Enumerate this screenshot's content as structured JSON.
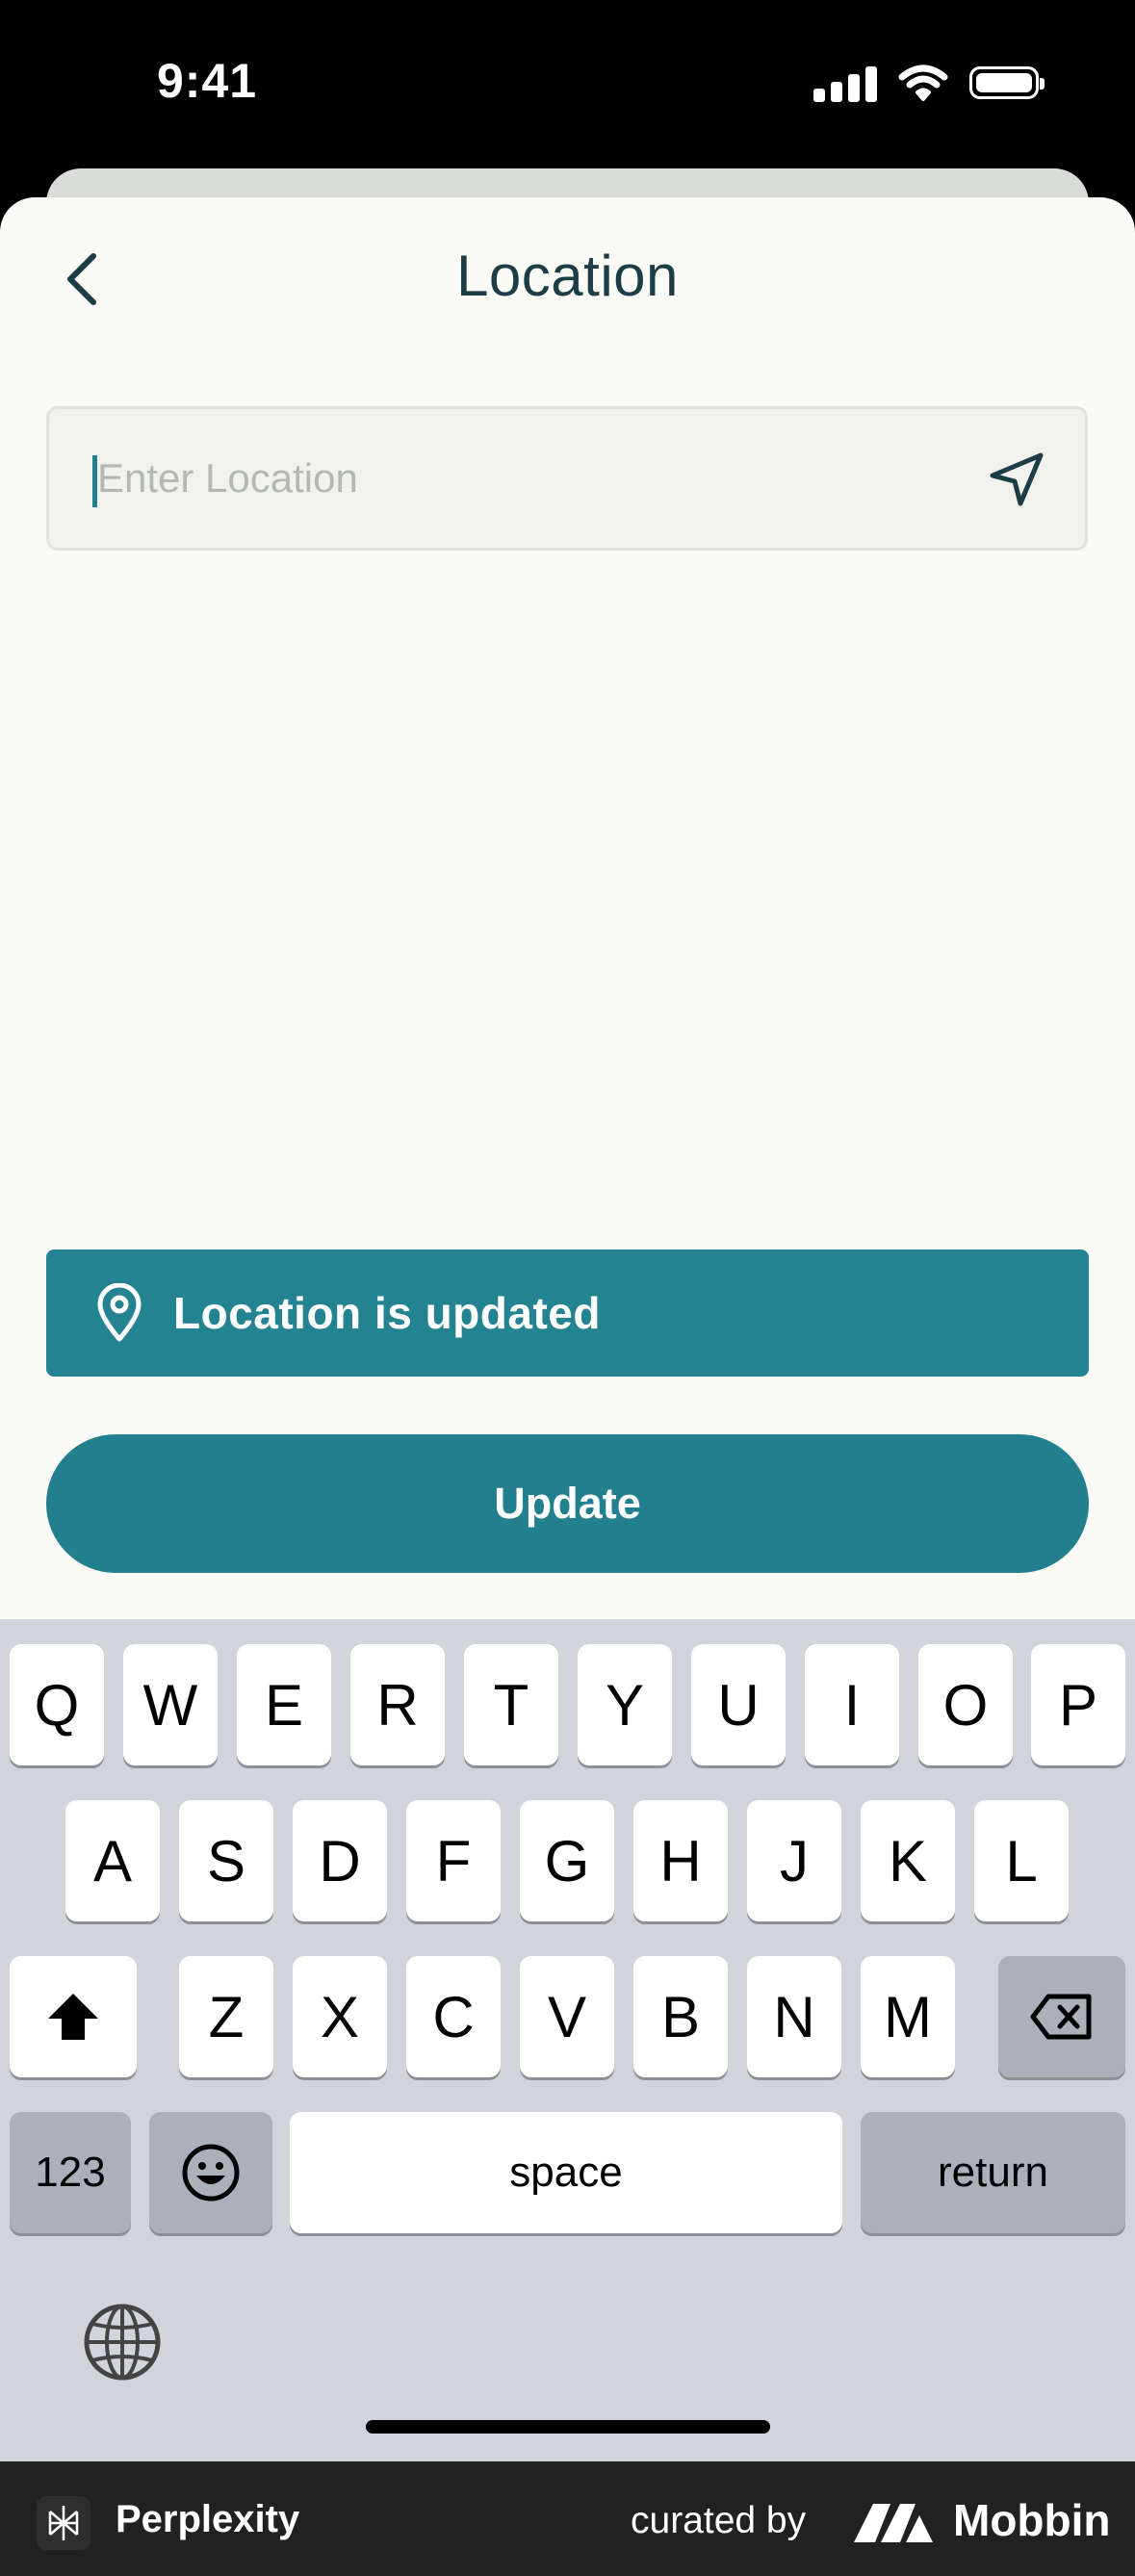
{
  "status_bar": {
    "time": "9:41"
  },
  "header": {
    "title": "Location",
    "back_icon": "chevron-left-icon"
  },
  "search": {
    "placeholder": "Enter Location",
    "value": "",
    "action_icon": "navigation-arrow-icon"
  },
  "toast": {
    "icon": "map-pin-icon",
    "message": "Location is updated"
  },
  "primary_action": {
    "label": "Update"
  },
  "keyboard": {
    "row1": [
      "Q",
      "W",
      "E",
      "R",
      "T",
      "Y",
      "U",
      "I",
      "O",
      "P"
    ],
    "row2": [
      "A",
      "S",
      "D",
      "F",
      "G",
      "H",
      "J",
      "K",
      "L"
    ],
    "row3": [
      "Z",
      "X",
      "C",
      "V",
      "B",
      "N",
      "M"
    ],
    "numbers_label": "123",
    "space_label": "space",
    "return_label": "return"
  },
  "footer": {
    "app_name": "Perplexity",
    "curated_label": "curated by",
    "brand": "Mobbin"
  },
  "colors": {
    "accent": "#227f8d",
    "toast": "#238390",
    "title": "#1c3d46",
    "sheet": "#fafaf7",
    "keyboard": "#d1d4db"
  }
}
